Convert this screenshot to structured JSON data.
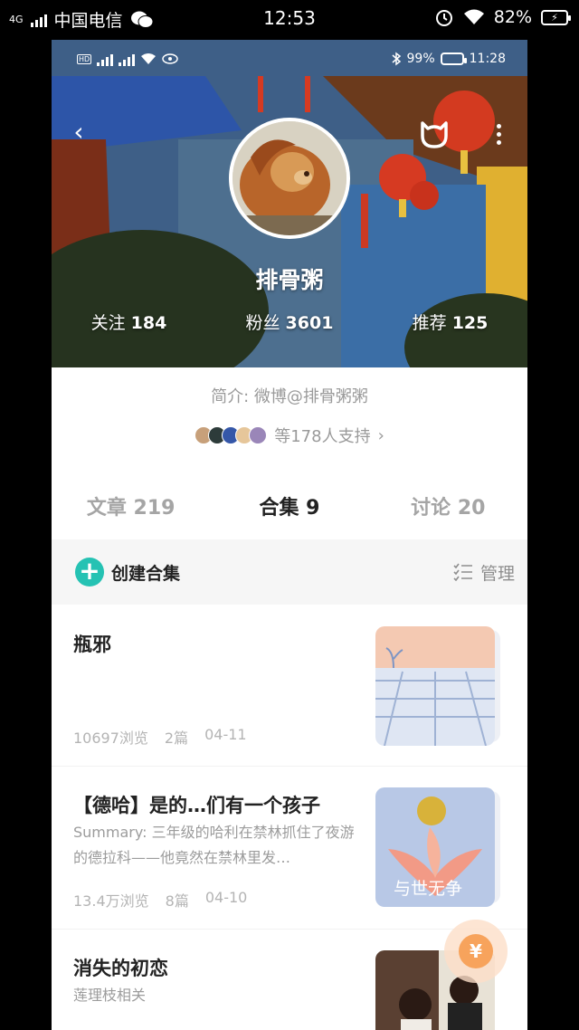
{
  "outer_status": {
    "carrier": "中国电信",
    "network": "4G",
    "time": "12:53",
    "battery": "82%"
  },
  "inner_status": {
    "battery": "99%",
    "time": "11:28"
  },
  "profile": {
    "username": "排骨粥",
    "following_label": "关注",
    "following": "184",
    "fans_label": "粉丝",
    "fans": "3601",
    "recommend_label": "推荐",
    "recommend": "125",
    "intro": "简介: 微博@排骨粥粥",
    "supporters": "等178人支持",
    "supporters_arrow": "›"
  },
  "tabs": [
    {
      "label": "文章 219"
    },
    {
      "label": "合集 9"
    },
    {
      "label": "讨论 20"
    }
  ],
  "actions": {
    "create": "创建合集",
    "manage": "管理",
    "plus": "+"
  },
  "collections": [
    {
      "title": "瓶邪",
      "summary": "",
      "views": "10697浏览",
      "count": "2篇",
      "date": "04-11",
      "thumb_caption": ""
    },
    {
      "title": "【德哈】是的…们有一个孩子",
      "summary": "Summary: 三年级的哈利在禁林抓住了夜游的德拉科——他竟然在禁林里发…",
      "views": "13.4万浏览",
      "count": "8篇",
      "date": "04-10",
      "thumb_caption": "与世无争"
    },
    {
      "title": "消失的初恋",
      "summary": "莲理枝相关",
      "views": "",
      "count": "",
      "date": "",
      "thumb_caption": ""
    }
  ],
  "icons": {
    "back": "‹",
    "reward": "¥"
  },
  "colors": {
    "accent": "#25c2b3",
    "reward": "#f7a35c"
  }
}
